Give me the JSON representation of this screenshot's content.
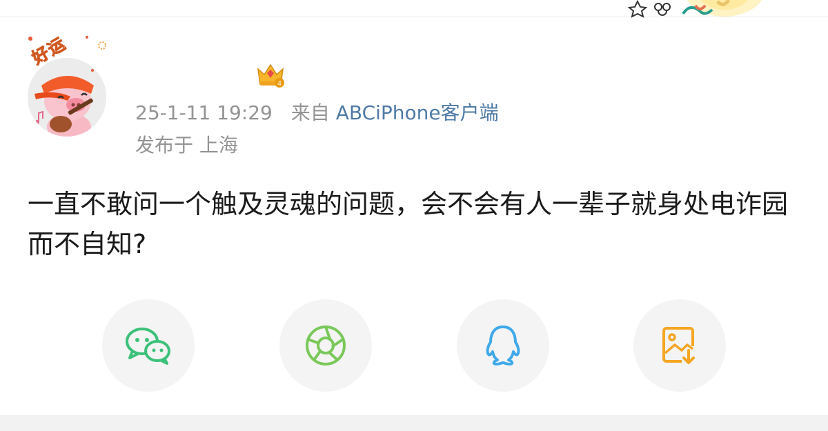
{
  "post": {
    "time": "25-1-11 19:29",
    "source_prefix": "来自",
    "source": "ABCiPhone客户端",
    "location": "发布于 上海",
    "text": "一直不敢问一个触及灵魂的问题，会不会有人一辈子就身处电诈园而不自知?"
  },
  "avatar": {
    "badge_text": "好运"
  },
  "vip": {
    "level": "4"
  },
  "share": [
    {
      "icon": "wechat-icon",
      "color": "#3cc17a"
    },
    {
      "icon": "moments-icon",
      "color": "#7ac85a"
    },
    {
      "icon": "qq-icon",
      "color": "#3fa9ea"
    },
    {
      "icon": "save-image-icon",
      "color": "#f5a623"
    }
  ]
}
